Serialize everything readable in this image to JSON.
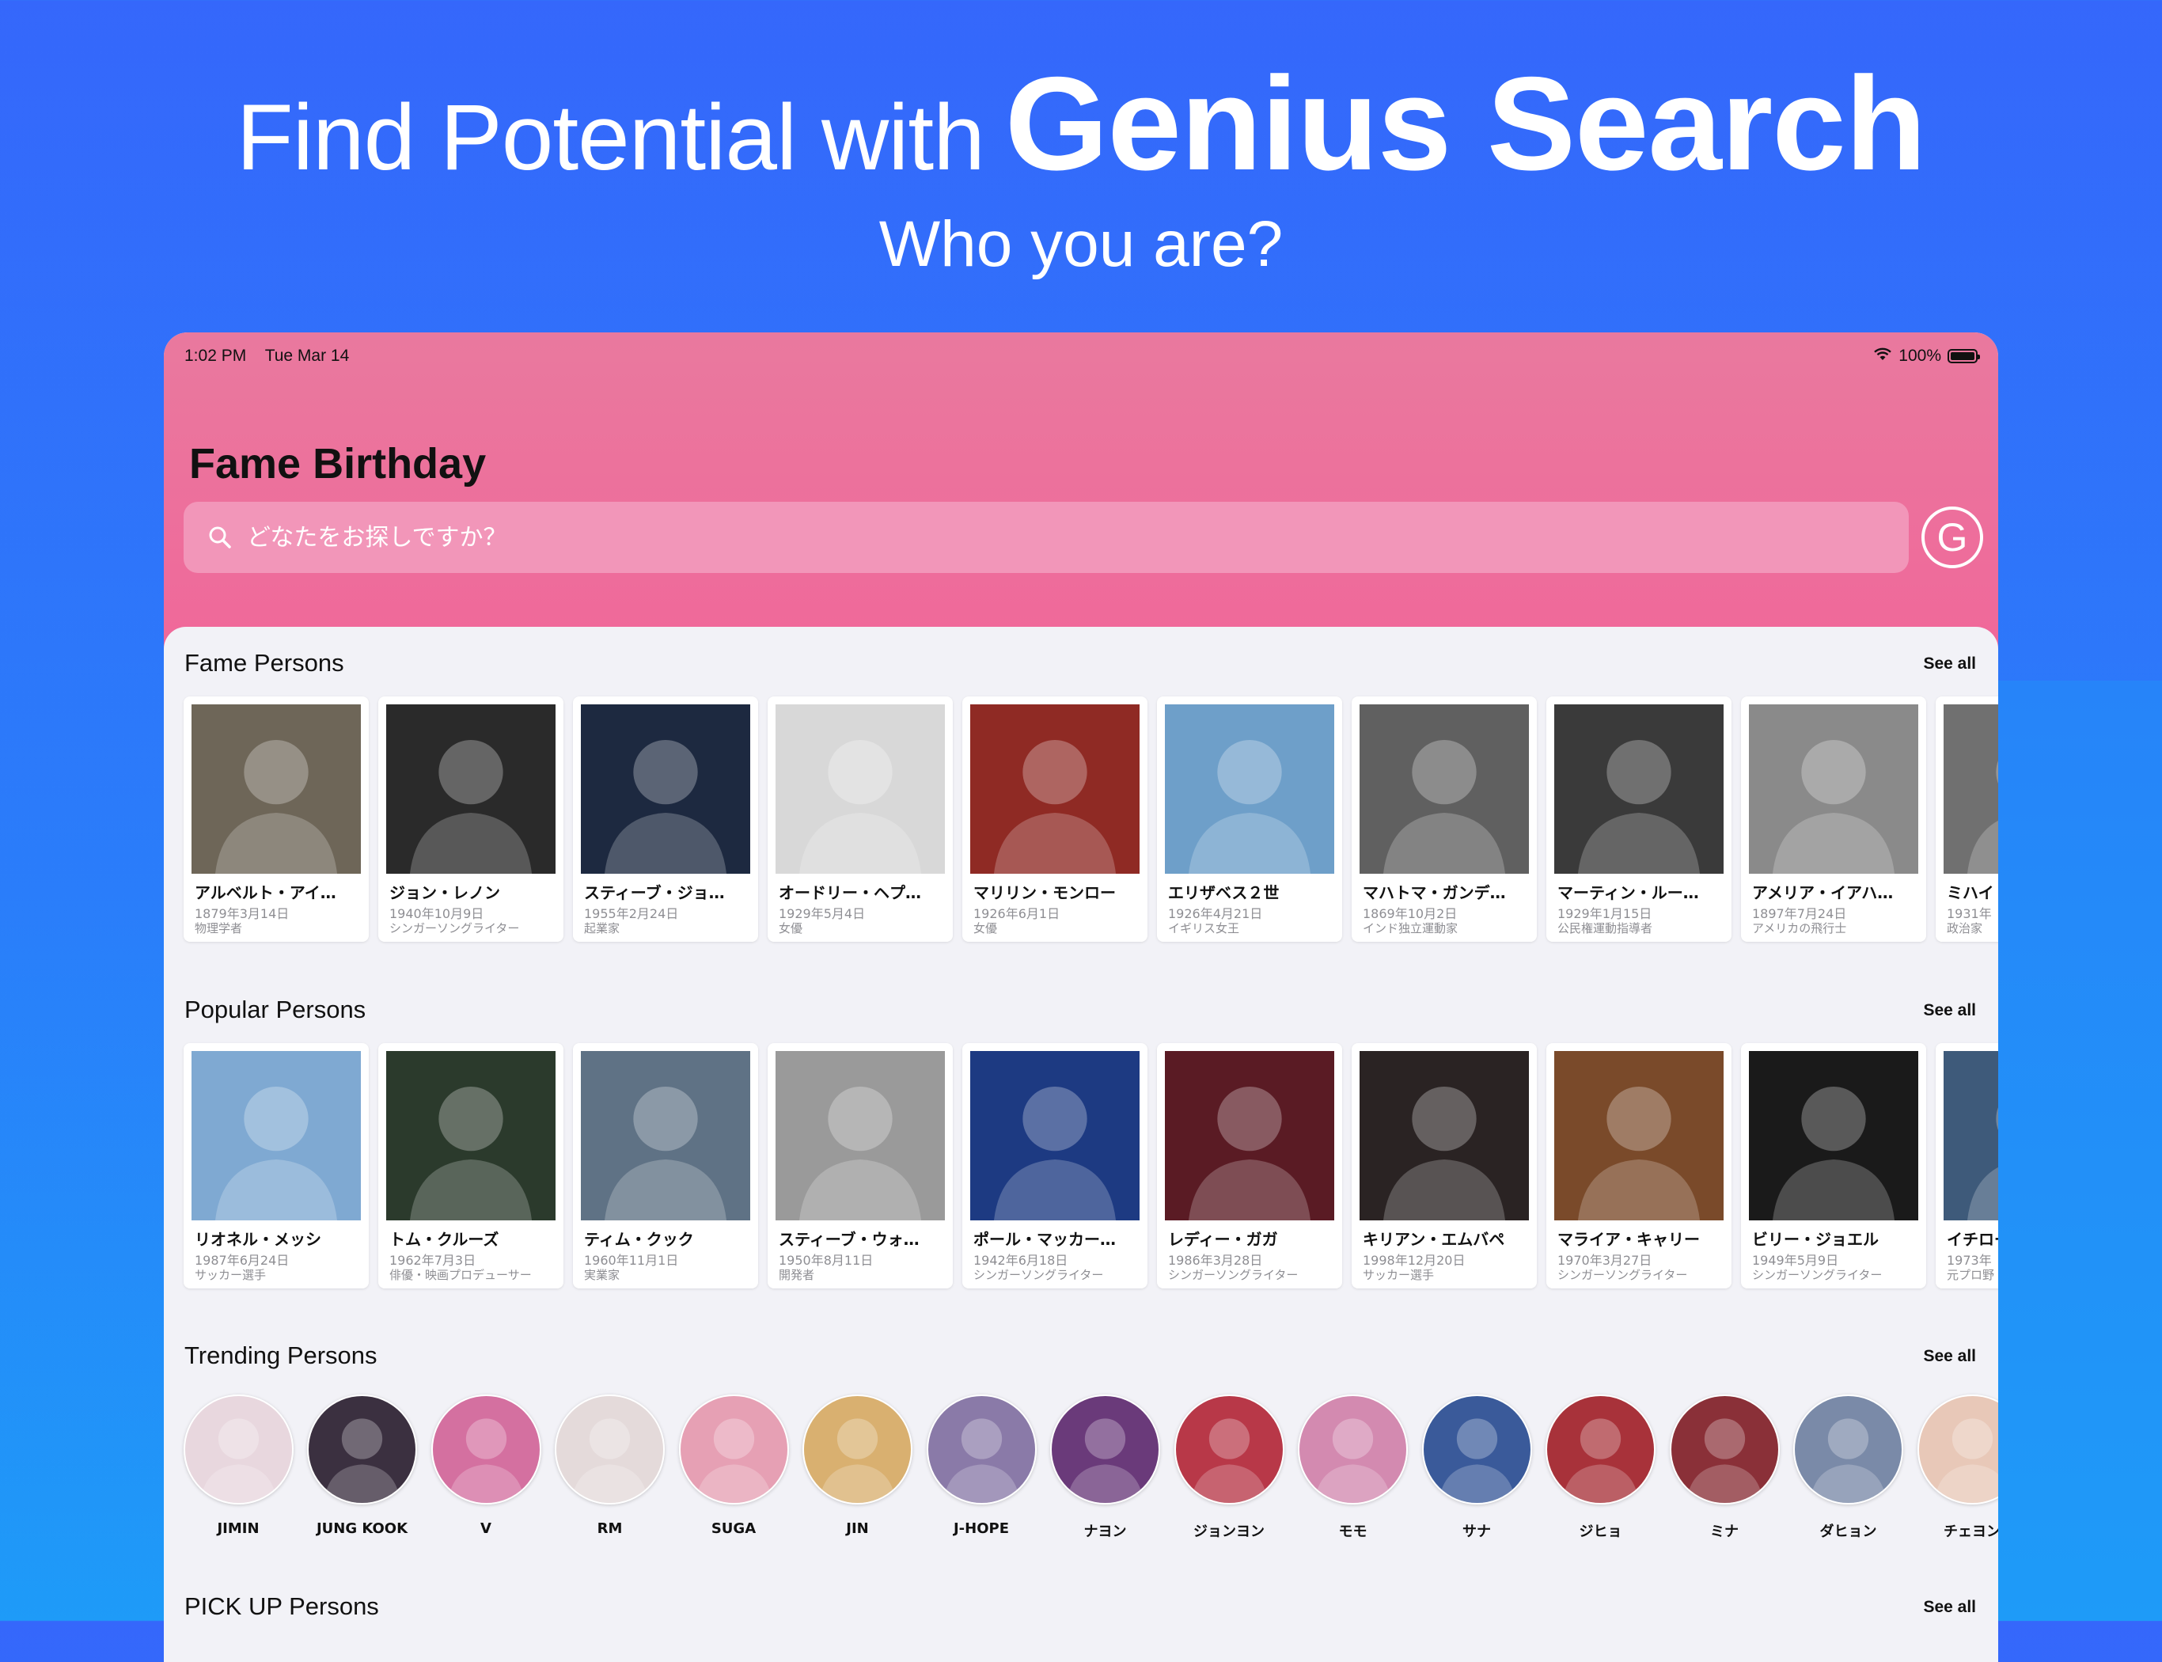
{
  "promo": {
    "headline_light": "Find Potential with",
    "headline_bold": "Genius Search",
    "subheadline": "Who you are?"
  },
  "status_bar": {
    "time": "1:02 PM",
    "date": "Tue Mar 14",
    "battery": "100%"
  },
  "app": {
    "title": "Fame Birthday",
    "search_placeholder": "どなたをお探しですか？",
    "g_button_label": "G"
  },
  "sections": {
    "fame": {
      "title": "Fame Persons",
      "see_all": "See all"
    },
    "popular": {
      "title": "Popular Persons",
      "see_all": "See all"
    },
    "trending": {
      "title": "Trending Persons",
      "see_all": "See all"
    },
    "pickup": {
      "title": "PICK UP Persons",
      "see_all": "See all"
    }
  },
  "fame_persons": [
    {
      "name": "アルベルト・アイ…",
      "date": "1879年3月14日",
      "job": "物理学者",
      "tone": "#6e6658"
    },
    {
      "name": "ジョン・レノン",
      "date": "1940年10月9日",
      "job": "シンガーソングライター",
      "tone": "#2a2a2a"
    },
    {
      "name": "スティーブ・ジョ…",
      "date": "1955年2月24日",
      "job": "起業家",
      "tone": "#1d2940"
    },
    {
      "name": "オードリー・ヘプ…",
      "date": "1929年5月4日",
      "job": "女優",
      "tone": "#d8d8d8"
    },
    {
      "name": "マリリン・モンロー",
      "date": "1926年6月1日",
      "job": "女優",
      "tone": "#8f2a24"
    },
    {
      "name": "エリザベス２世",
      "date": "1926年4月21日",
      "job": "イギリス女王",
      "tone": "#6e9fc9"
    },
    {
      "name": "マハトマ・ガンデ…",
      "date": "1869年10月2日",
      "job": "インド独立運動家",
      "tone": "#606060"
    },
    {
      "name": "マーティン・ルー…",
      "date": "1929年1月15日",
      "job": "公民権運動指導者",
      "tone": "#3a3a3a"
    },
    {
      "name": "アメリア・イアハ…",
      "date": "1897年7月24日",
      "job": "アメリカの飛行士",
      "tone": "#8a8a8a"
    },
    {
      "name": "ミハイ",
      "date": "1931年",
      "job": "政治家",
      "tone": "#707070"
    }
  ],
  "popular_persons": [
    {
      "name": "リオネル・メッシ",
      "date": "1987年6月24日",
      "job": "サッカー選手",
      "tone": "#7fa9d2"
    },
    {
      "name": "トム・クルーズ",
      "date": "1962年7月3日",
      "job": "俳優・映画プロデューサー",
      "tone": "#2b3a2c"
    },
    {
      "name": "ティム・クック",
      "date": "1960年11月1日",
      "job": "実業家",
      "tone": "#5f7285"
    },
    {
      "name": "スティーブ・ウォ…",
      "date": "1950年8月11日",
      "job": "開発者",
      "tone": "#9a9a9a"
    },
    {
      "name": "ポール・マッカー…",
      "date": "1942年6月18日",
      "job": "シンガーソングライター",
      "tone": "#1d3a82"
    },
    {
      "name": "レディー・ガガ",
      "date": "1986年3月28日",
      "job": "シンガーソングライター",
      "tone": "#5a1b24"
    },
    {
      "name": "キリアン・エムバペ",
      "date": "1998年12月20日",
      "job": "サッカー選手",
      "tone": "#2a2323"
    },
    {
      "name": "マライア・キャリー",
      "date": "1970年3月27日",
      "job": "シンガーソングライター",
      "tone": "#7a4a2a"
    },
    {
      "name": "ビリー・ジョエル",
      "date": "1949年5月9日",
      "job": "シンガーソングライター",
      "tone": "#1a1a1a"
    },
    {
      "name": "イチロー",
      "date": "1973年",
      "job": "元プロ野",
      "tone": "#3e5a7a"
    }
  ],
  "trending_persons": [
    {
      "name": "JIMIN",
      "tone": "#e8d7de"
    },
    {
      "name": "JUNG KOOK",
      "tone": "#3b3040"
    },
    {
      "name": "V",
      "tone": "#d470a0"
    },
    {
      "name": "RM",
      "tone": "#e4dada"
    },
    {
      "name": "SUGA",
      "tone": "#e6a0b4"
    },
    {
      "name": "JIN",
      "tone": "#d9b070"
    },
    {
      "name": "J-HOPE",
      "tone": "#8a7aa8"
    },
    {
      "name": "ナヨン",
      "tone": "#6a3a7a"
    },
    {
      "name": "ジョンヨン",
      "tone": "#b83848"
    },
    {
      "name": "モモ",
      "tone": "#d38ab0"
    },
    {
      "name": "サナ",
      "tone": "#3a5a9a"
    },
    {
      "name": "ジヒョ",
      "tone": "#a8323a"
    },
    {
      "name": "ミナ",
      "tone": "#8a3038"
    },
    {
      "name": "ダヒョン",
      "tone": "#7a8aa8"
    },
    {
      "name": "チェヨン",
      "tone": "#e8c8b8"
    }
  ],
  "colors": {
    "background_top": "#3567fb",
    "background_bottom": "#1e9bf8",
    "header_pink": "#f0689a",
    "search_pink": "#f296b9"
  }
}
